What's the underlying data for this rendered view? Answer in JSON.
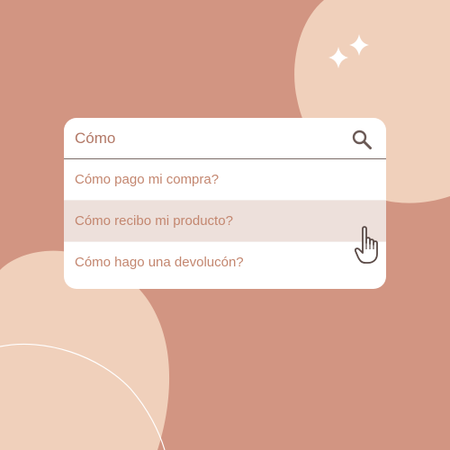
{
  "colors": {
    "background": "#d29582",
    "blob": "#f0d0bb",
    "panel": "#ffffff",
    "text": "#c3866f",
    "input_text": "#b27866",
    "highlight": "#ede0db",
    "icon": "#6b5a56"
  },
  "search": {
    "value": "Cómo",
    "icon": "search-icon"
  },
  "results": [
    {
      "label": "Cómo pago mi compra?",
      "highlighted": false
    },
    {
      "label": "Cómo recibo mi producto?",
      "highlighted": true
    },
    {
      "label": "Cómo hago una devolucón?",
      "highlighted": false
    }
  ],
  "decorations": {
    "cursor": "hand-pointer-icon",
    "sparkles": "sparkle-icon"
  }
}
